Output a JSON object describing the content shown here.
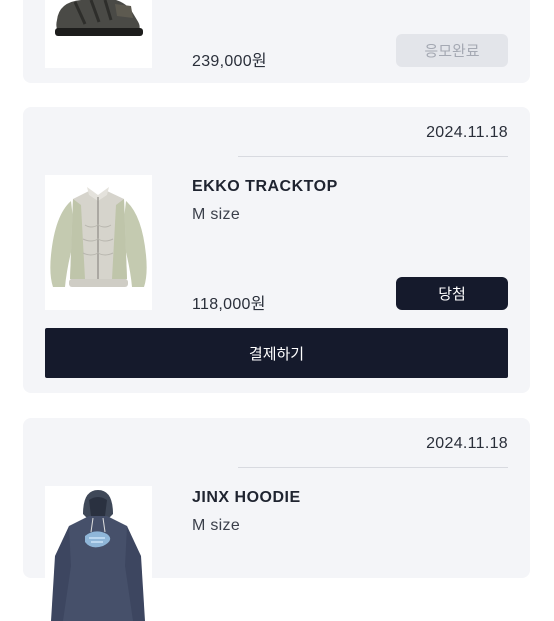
{
  "orders": [
    {
      "image": "sneaker-image",
      "price": "239,000원",
      "status": "응모완료"
    },
    {
      "date": "2024.11.18",
      "image": "tracktop-jacket-image",
      "name": "EKKO TRACKTOP",
      "size": "M size",
      "price": "118,000원",
      "status": "당첨",
      "pay_label": "결제하기"
    },
    {
      "date": "2024.11.18",
      "image": "hoodie-image",
      "name": "JINX HOODIE",
      "size": "M size"
    }
  ],
  "colors": {
    "card_bg": "#f4f5f8",
    "primary_dark": "#151a2c",
    "disabled_bg": "#e3e5ea",
    "disabled_text": "#a5a9b3"
  }
}
